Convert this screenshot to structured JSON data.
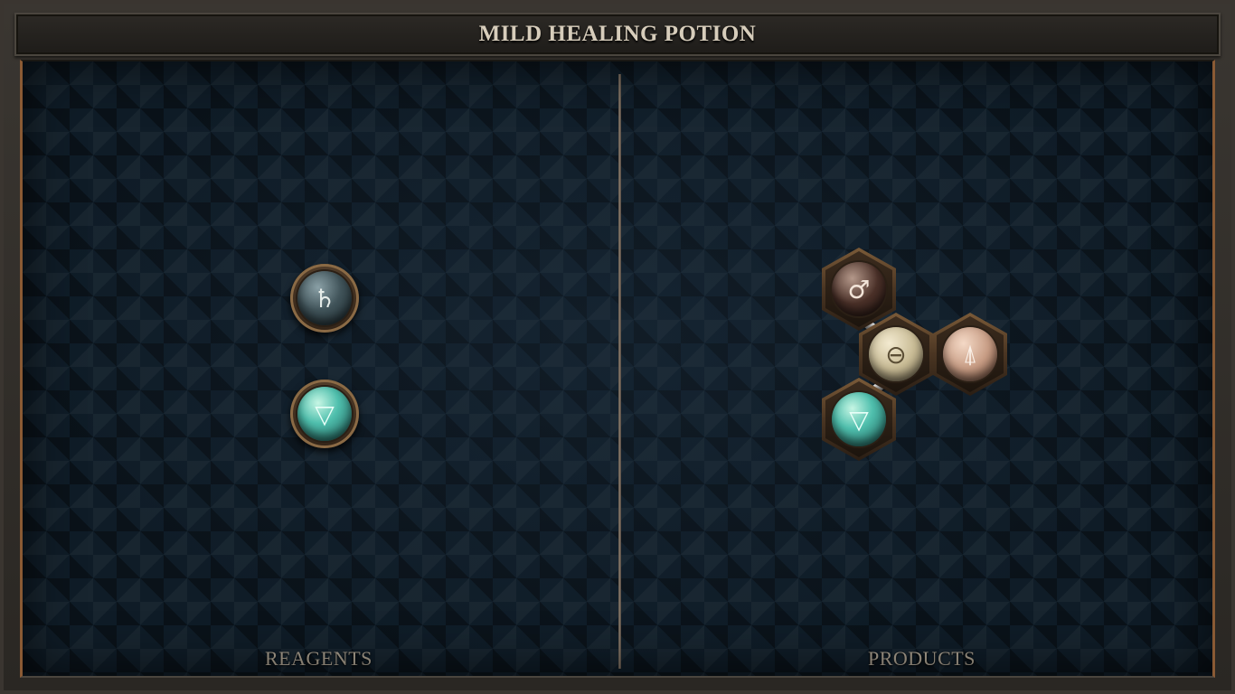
{
  "title": "MILD HEALING POTION",
  "reagents": {
    "label": "REAGENTS",
    "atoms": [
      {
        "element": "saturn",
        "glyph": "♄"
      },
      {
        "element": "water",
        "glyph": "▽"
      }
    ]
  },
  "products": {
    "label": "PRODUCTS",
    "molecule": [
      {
        "element": "mars",
        "glyph": "♂"
      },
      {
        "element": "salt",
        "glyph": "⊖"
      },
      {
        "element": "metal",
        "glyph": "⍋"
      },
      {
        "element": "water",
        "glyph": "▽"
      }
    ]
  },
  "colors": {
    "board": "#0f1c27",
    "frame": "#2b2824",
    "accent_copper": "#8a5a34",
    "title_text": "#d7cdbb",
    "label_text": "#a99f8f"
  }
}
